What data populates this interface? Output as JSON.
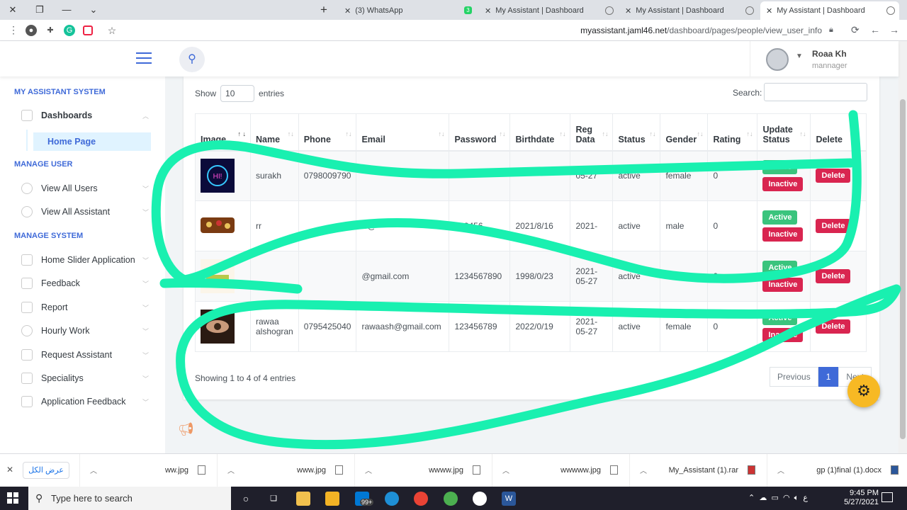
{
  "browser": {
    "tabs": [
      {
        "label": "(3) WhatsApp",
        "badge": "3"
      },
      {
        "label": "My Assistant | Dashboard"
      },
      {
        "label": "My Assistant | Dashboard"
      },
      {
        "label": "My Assistant | Dashboard"
      }
    ],
    "url_host": "myassistant.jaml46.net",
    "url_path": "/dashboard/pages/people/view_user_info"
  },
  "header": {
    "user_name": "Roaa Kh",
    "user_role": "mannager"
  },
  "sidebar": {
    "sections": [
      {
        "title": "MY ASSISTANT SYSTEM"
      },
      {
        "title": "MANAGE USER"
      },
      {
        "title": "MANAGE SYSTEM"
      }
    ],
    "dashboards": "Dashboards",
    "home_page": "Home Page",
    "user_items": [
      "View All Users",
      "View All Assistant"
    ],
    "system_items": [
      "Home Slider Application",
      "Feedback",
      "Report",
      "Hourly Work",
      "Request Assistant",
      "Specialitys",
      "Application Feedback"
    ]
  },
  "table_controls": {
    "show_label": "Show",
    "entries_value": "10",
    "entries_label": "entries",
    "search_label": "Search:"
  },
  "table": {
    "columns": [
      "Image",
      "Name",
      "Phone",
      "Email",
      "Password",
      "Birthdate",
      "Reg Data",
      "Status",
      "Gender",
      "Rating",
      "Update Status",
      "Delete"
    ],
    "rows": [
      {
        "name": "surakh",
        "phone": "0798009790",
        "email": "",
        "password": "",
        "birthdate": "",
        "reg": "05-27",
        "status": "active",
        "gender": "female",
        "rating": "0"
      },
      {
        "name": "rr",
        "phone": "",
        "email": "rr@",
        "password": "123456",
        "birthdate": "2021/8/16",
        "reg": "2021-",
        "status": "active",
        "gender": "male",
        "rating": "0"
      },
      {
        "name": "",
        "phone": "",
        "email": "@gmail.com",
        "password": "1234567890",
        "birthdate": "1998/0/23",
        "reg": "2021-05-27",
        "status": "active",
        "gender": "female",
        "rating": "0"
      },
      {
        "name": "rawaa alshogran",
        "phone": "0795425040",
        "email": "rawaash@gmail.com",
        "password": "123456789",
        "birthdate": "2022/0/19",
        "reg": "2021-05-27",
        "status": "active",
        "gender": "female",
        "rating": "0"
      }
    ],
    "btn_active": "Active",
    "btn_inactive": "Inactive",
    "btn_delete": "Delete"
  },
  "pagination": {
    "info": "Showing 1 to 4 of 4 entries",
    "previous": "Previous",
    "current": "1",
    "next": "Next"
  },
  "downloads": {
    "show_all": "عرض الكل",
    "files": [
      "ww.jpg",
      "www.jpg",
      "wwww.jpg",
      "wwwww.jpg",
      "My_Assistant (1).rar",
      "gp (1)final (1).docx"
    ]
  },
  "taskbar": {
    "search_placeholder": "Type here to search",
    "badge": "99+",
    "time": "9:45 PM",
    "date": "5/27/2021",
    "lang": "ع"
  },
  "colors": {
    "accent": "#3f6ad8",
    "success": "#3ac47d",
    "danger": "#d92550",
    "scribble": "#19f0b0",
    "gear": "#f7b924"
  }
}
